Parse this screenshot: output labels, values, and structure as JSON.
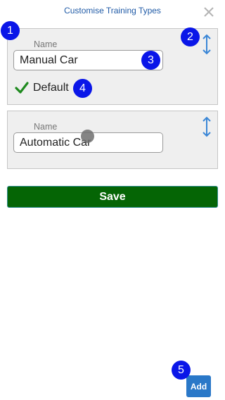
{
  "header": {
    "title": "Customise Training Types",
    "close_icon": "close-icon"
  },
  "training_types": [
    {
      "name_label": "Name",
      "name_value": "Manual Car",
      "default_label": "Default",
      "is_default": true
    },
    {
      "name_label": "Name",
      "name_value": "Automatic Car"
    }
  ],
  "actions": {
    "save_label": "Save",
    "add_label": "Add"
  },
  "annotations": {
    "m1": "1",
    "m2": "2",
    "m3": "3",
    "m4": "4",
    "m5": "5"
  },
  "colors": {
    "title": "#1f5aa6",
    "save_bg": "#056505",
    "add_bg": "#2a78c8",
    "marker": "#0a16e8",
    "check": "#1f8a1f",
    "drag_handle": "#3a86d6"
  }
}
